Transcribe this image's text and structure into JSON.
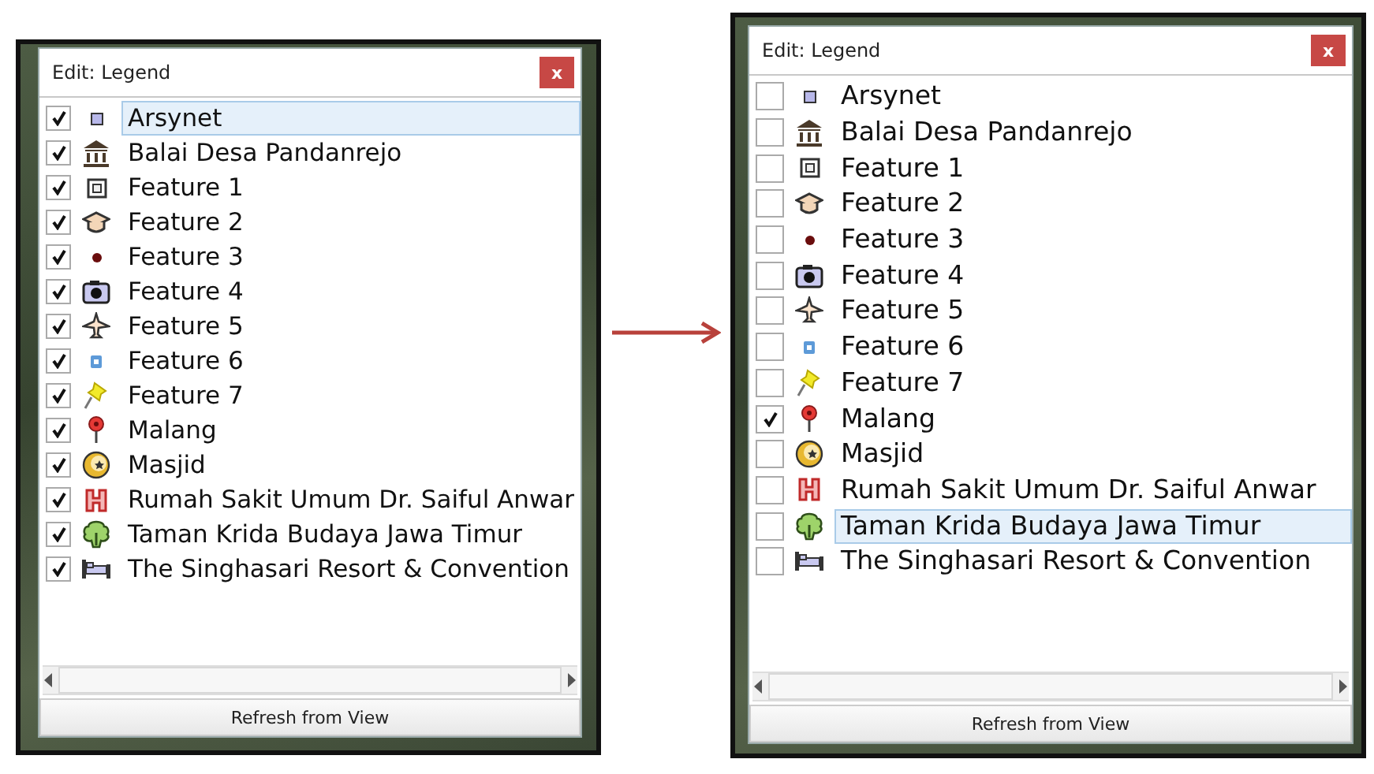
{
  "panels": [
    {
      "title": "Edit: Legend",
      "close": "x",
      "button": "Refresh from View",
      "items": [
        {
          "label": "Arsynet",
          "kind": "square",
          "checked": true,
          "selected": true
        },
        {
          "label": "Balai Desa Pandanrejo",
          "kind": "building",
          "checked": true,
          "selected": false
        },
        {
          "label": "Feature 1",
          "kind": "frame",
          "checked": true,
          "selected": false
        },
        {
          "label": "Feature 2",
          "kind": "cap",
          "checked": true,
          "selected": false
        },
        {
          "label": "Feature 3",
          "kind": "dot",
          "checked": true,
          "selected": false
        },
        {
          "label": "Feature 4",
          "kind": "camera",
          "checked": true,
          "selected": false
        },
        {
          "label": "Feature 5",
          "kind": "plane",
          "checked": true,
          "selected": false
        },
        {
          "label": "Feature 6",
          "kind": "chip",
          "checked": true,
          "selected": false
        },
        {
          "label": "Feature 7",
          "kind": "pin",
          "checked": true,
          "selected": false
        },
        {
          "label": "Malang",
          "kind": "marker",
          "checked": true,
          "selected": false
        },
        {
          "label": "Masjid",
          "kind": "crescent",
          "checked": true,
          "selected": false
        },
        {
          "label": "Rumah Sakit Umum Dr. Saiful Anwar",
          "kind": "hospital",
          "checked": true,
          "selected": false
        },
        {
          "label": "Taman Krida Budaya Jawa Timur",
          "kind": "tree",
          "checked": true,
          "selected": false
        },
        {
          "label": "The Singhasari Resort & Convention",
          "kind": "bed",
          "checked": true,
          "selected": false
        }
      ]
    },
    {
      "title": "Edit: Legend",
      "close": "x",
      "button": "Refresh from View",
      "items": [
        {
          "label": "Arsynet",
          "kind": "square",
          "checked": false,
          "selected": false
        },
        {
          "label": "Balai Desa Pandanrejo",
          "kind": "building",
          "checked": false,
          "selected": false
        },
        {
          "label": "Feature 1",
          "kind": "frame",
          "checked": false,
          "selected": false
        },
        {
          "label": "Feature 2",
          "kind": "cap",
          "checked": false,
          "selected": false
        },
        {
          "label": "Feature 3",
          "kind": "dot",
          "checked": false,
          "selected": false
        },
        {
          "label": "Feature 4",
          "kind": "camera",
          "checked": false,
          "selected": false
        },
        {
          "label": "Feature 5",
          "kind": "plane",
          "checked": false,
          "selected": false
        },
        {
          "label": "Feature 6",
          "kind": "chip",
          "checked": false,
          "selected": false
        },
        {
          "label": "Feature 7",
          "kind": "pin",
          "checked": false,
          "selected": false
        },
        {
          "label": "Malang",
          "kind": "marker",
          "checked": true,
          "selected": false
        },
        {
          "label": "Masjid",
          "kind": "crescent",
          "checked": false,
          "selected": false
        },
        {
          "label": "Rumah Sakit Umum Dr. Saiful Anwar",
          "kind": "hospital",
          "checked": false,
          "selected": false
        },
        {
          "label": "Taman Krida Budaya Jawa Timur",
          "kind": "tree",
          "checked": false,
          "selected": true
        },
        {
          "label": "The Singhasari Resort & Convention",
          "kind": "bed",
          "checked": false,
          "selected": false
        }
      ]
    }
  ]
}
